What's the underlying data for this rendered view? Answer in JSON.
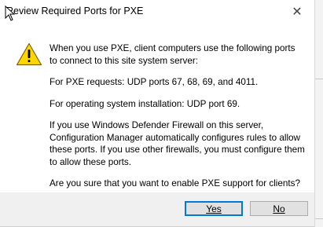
{
  "dialog": {
    "title": "Review Required Ports for PXE",
    "close_glyph": "✕",
    "icon": "warning-triangle-icon",
    "messages": [
      "When you use PXE, client computers use the following ports to connect to this site system server:",
      "For PXE requests: UDP ports 67, 68, 69, and 4011.",
      "For operating system installation: UDP port 69.",
      "If you use Windows Defender Firewall on this server, Configuration Manager automatically configures rules to allow these ports. If you use other firewalls, you must configure them to allow these ports.",
      "Are you sure that you want to enable PXE support for clients?"
    ],
    "buttons": {
      "yes_label": "Yes",
      "no_label": "No"
    }
  },
  "colors": {
    "warning_fill": "#FFD700",
    "accent_border": "#0078d7"
  }
}
